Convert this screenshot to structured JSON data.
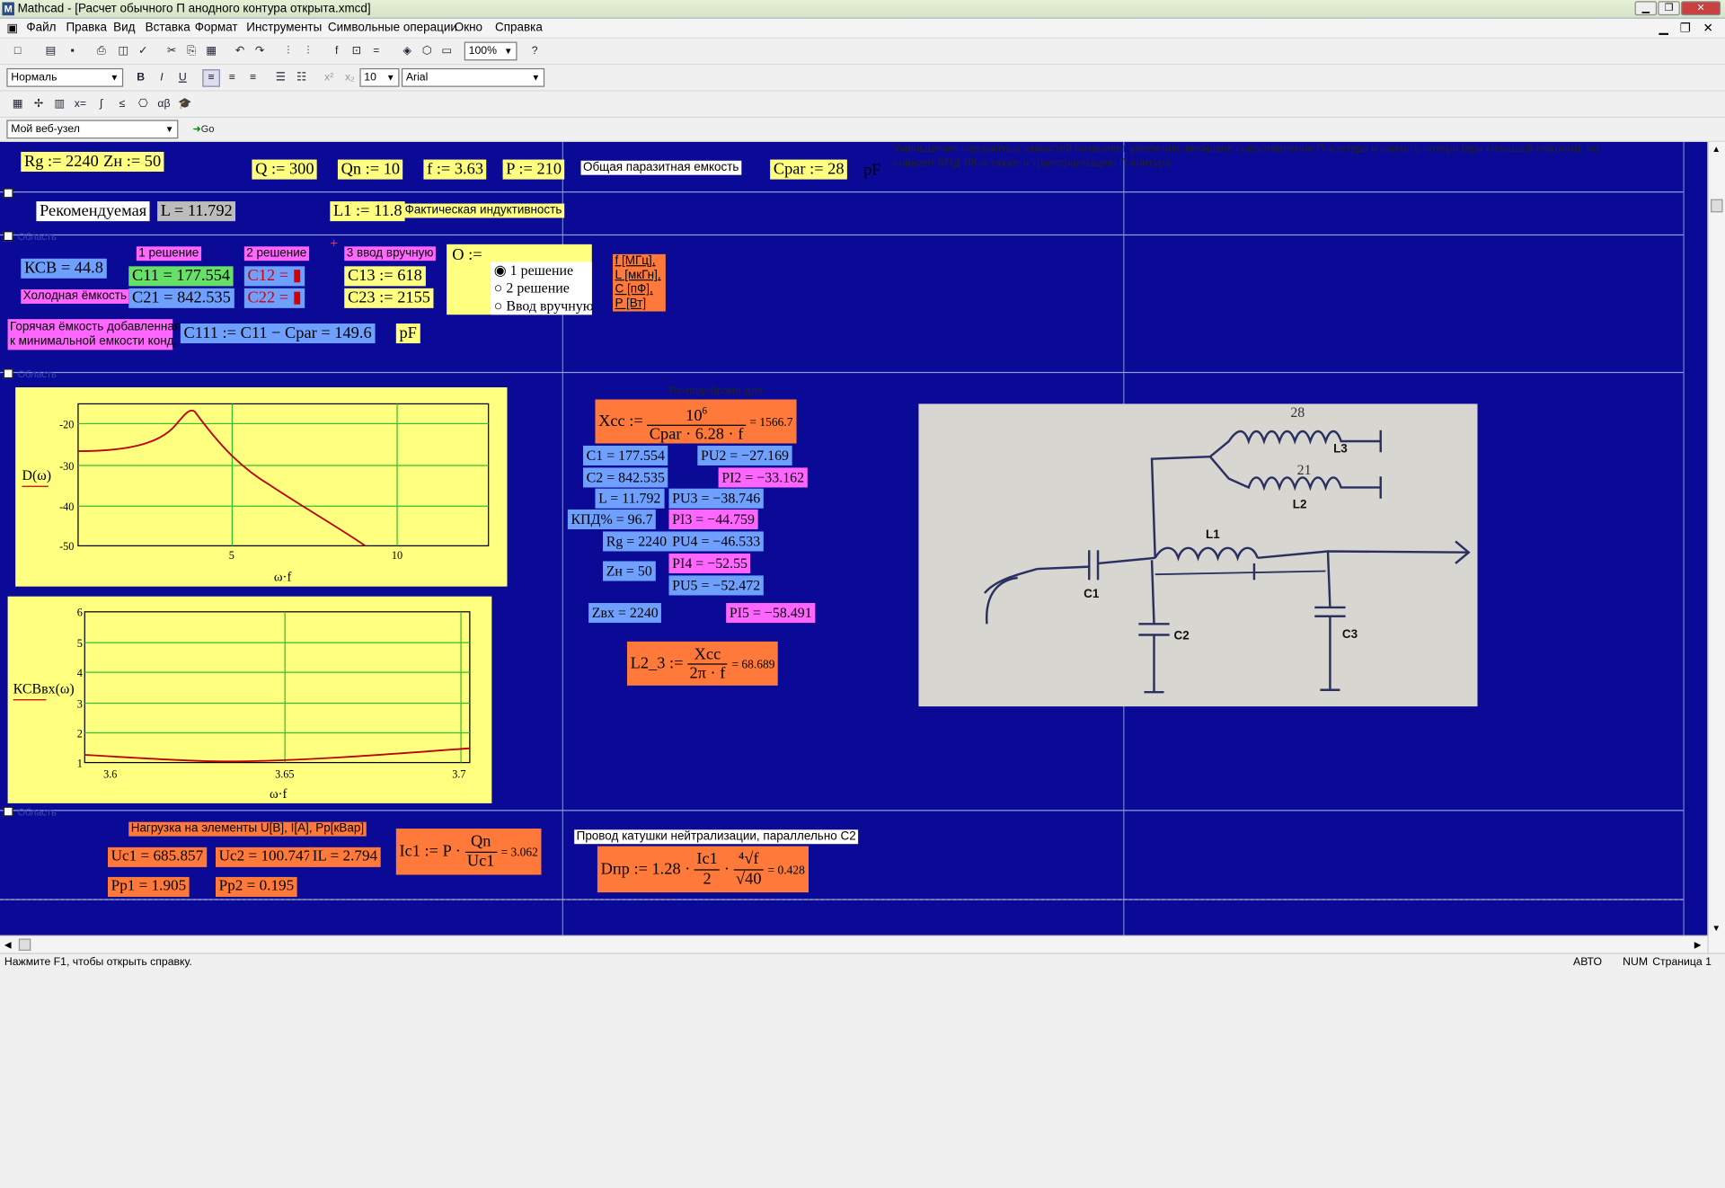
{
  "window": {
    "title": "Mathcad - [Расчет обычного П анодного контура открыта.xmcd]",
    "app_icon": "M"
  },
  "menu": [
    "Файл",
    "Правка",
    "Вид",
    "Вставка",
    "Формат",
    "Инструменты",
    "Символьные операции",
    "Окно",
    "Справка"
  ],
  "toolbar": {
    "zoom": "100%",
    "style": "Нормаль",
    "font_size": "10",
    "font": "Arial",
    "web": "Мой веб-узел",
    "go": "Go",
    "bold": "B",
    "italic": "I",
    "underline": "U"
  },
  "colors": {
    "sheet": "#0a0a96",
    "yellow": "#ffff80",
    "orange": "#ff7a3a",
    "blue": "#6fa0ff",
    "green": "#66e066",
    "pink": "#ff66ff"
  },
  "top": {
    "rg": "Rg := 2240",
    "zn": "Zн := 50",
    "q": "Q := 300",
    "qn": "Qn := 10",
    "f": "f := 3.63",
    "p": "P := 210",
    "cpar_label": "Общая паразитная емкость",
    "cpar": "Cpar := 28",
    "pf": "pF",
    "note": "Уменьшение паразитных емкостей позволяет увеличить волновое сопротивление П-контура и снизить потери (при меньшей емкости), но снижает КПД ИК-а также и трансформацию П-контура",
    "recommended": "Рекомендуемая",
    "l": "L = 11.792",
    "l1": "L1 := 11.8",
    "actual_label": "Фактическая индуктивность"
  },
  "region1": {
    "sol1": "1 решение",
    "sol2": "2 решение",
    "manual": "3 ввод вручную",
    "ksv": "КСВ = 44.8",
    "cold": "Холодная ёмкость",
    "c11": "C11 = 177.554",
    "c12": "C12 = ▮",
    "c13": "C13 := 618",
    "c21": "C21 = 842.535",
    "c22": "C22 = ▮",
    "c23": "C23 := 2155",
    "o_label": "O :=",
    "radios": [
      "1 решение",
      "2 решение",
      "Ввод вручную"
    ],
    "units": [
      "f [МГц],",
      "L [мкГн],",
      "С [пФ],",
      "P [Вт]"
    ],
    "hot": "Горячая ёмкость добавленная",
    "hot2": "к минимальной емкости конд.",
    "c111": "C111 := C11 − Cpar = 149.6",
    "pf": "pF"
  },
  "graph1": {
    "ylabel": "D(ω)",
    "xlabel": "ω·f",
    "yticks": [
      "-20",
      "-30",
      "-40",
      "-50"
    ],
    "xticks": [
      "5",
      "10"
    ]
  },
  "graph2": {
    "ylabel": "КСВвх(ω)",
    "xlabel": "ω·f",
    "yticks": [
      "6",
      "5",
      "4",
      "3",
      "2",
      "1"
    ],
    "xticks": [
      "3.6",
      "3.65",
      "3.7"
    ]
  },
  "calc": {
    "title": "Rc-подобрана для",
    "xcc_lhs": "Xcc :=",
    "xcc_num": "10",
    "xcc_exp": "6",
    "xcc_den": "Cpar · 6.28 · f",
    "xcc_val": "= 1566.7",
    "c1": "C1 = 177.554",
    "c2": "C2 = 842.535",
    "l": "L = 11.792",
    "kpd": "КПД% = 96.7",
    "rg": "Rg = 2240",
    "zn": "Zн = 50",
    "zvx": "Zвх = 2240",
    "pu2": "PU2 = −27.169",
    "pi2": "PI2 = −33.162",
    "pu3": "PU3 = −38.746",
    "pi3": "PI3 = −44.759",
    "pu4": "PU4 = −46.533",
    "pi4": "PI4 = −52.55",
    "pu5": "PU5 = −52.472",
    "pi5": "PI5 = −58.491",
    "l23_lhs": "L2_3 :=",
    "l23_num": "Xcc",
    "l23_den": "2π · f",
    "l23_val": "= 68.689"
  },
  "photo": {
    "labels": [
      "L3",
      "L2",
      "L1",
      "C1",
      "C2",
      "C3",
      "28",
      "21"
    ]
  },
  "bottom": {
    "load_label": "Нагрузка на элементы U[В], I[А], Pp[кВар]",
    "uc1": "Uc1 = 685.857",
    "uc2": "Uc2 = 100.747",
    "il": "IL = 2.794",
    "ic1_lhs": "Ic1 := P ·",
    "ic1_num": "Qn",
    "ic1_den": "Uc1",
    "ic1_val": "= 3.062",
    "pp1": "Pp1 = 1.905",
    "pp2": "Pp2 = 0.195",
    "wire_label": "Провод катушки нейтрализации, параллельно С2",
    "dpr_lhs": "Dпр := 1.28 ·",
    "dpr_num": "Ic1",
    "dpr_den": "2",
    "dpr_root": "⁴√f",
    "dpr_root_den": "√40",
    "dpr_val": "= 0.428"
  },
  "status": {
    "help": "Нажмите F1, чтобы открыть справку.",
    "auto": "АВТО",
    "num": "NUM",
    "page": "Страница 1"
  },
  "region_labels": [
    "Rg :=",
    "Zн :=",
    "Q :=",
    "Область",
    "Область",
    "Область"
  ]
}
